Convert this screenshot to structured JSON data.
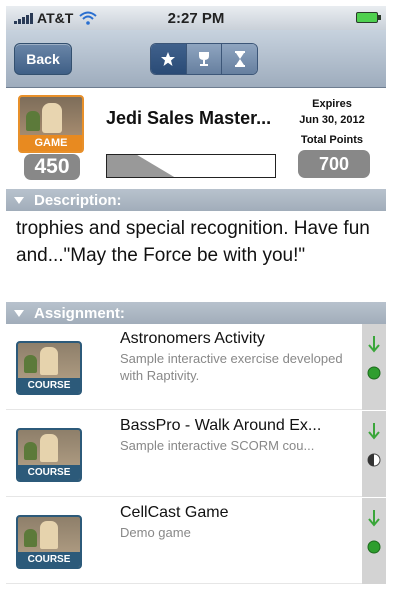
{
  "status_bar": {
    "carrier": "AT&T",
    "time": "2:27 PM"
  },
  "nav": {
    "back_label": "Back"
  },
  "badge": {
    "image_tag": "GAME",
    "points": "450",
    "title": "Jedi Sales Master...",
    "progress_fraction": 0.4,
    "expires_label": "Expires",
    "expires_date": "Jun 30, 2012",
    "total_points_label": "Total Points",
    "total_points": "700"
  },
  "description": {
    "header": "Description:",
    "text": "trophies and special recognition. Have fun and...\"May the Force be with you!\""
  },
  "assignment": {
    "header": "Assignment:",
    "items": [
      {
        "tag": "COURSE",
        "title": "Astronomers Activity",
        "desc": "Sample interactive exercise developed with Raptivity.",
        "status": "complete"
      },
      {
        "tag": "COURSE",
        "title": "BassPro - Walk Around Ex...",
        "desc": "Sample interactive SCORM cou...",
        "status": "half"
      },
      {
        "tag": "COURSE",
        "title": "CellCast Game",
        "desc": "Demo game",
        "status": "complete"
      }
    ]
  },
  "colors": {
    "status_green": "#2e9e2e",
    "badge_orange": "#e8902a",
    "nav_blue": "#40618c"
  }
}
